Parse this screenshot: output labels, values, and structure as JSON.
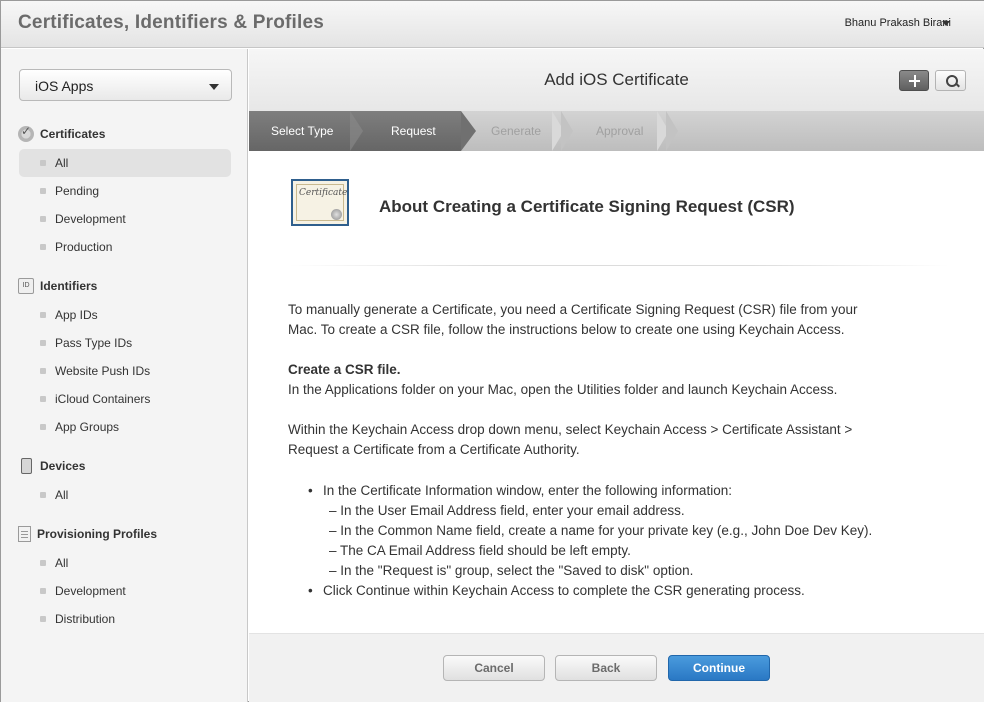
{
  "header": {
    "app_title": "Certificates, Identifiers & Profiles",
    "user_name": "Bhanu Prakash Birani"
  },
  "sidebar": {
    "app_select": "iOS Apps",
    "sections": [
      {
        "title": "Certificates",
        "icon": "certificate-icon",
        "items": [
          "All",
          "Pending",
          "Development",
          "Production"
        ],
        "active": "All"
      },
      {
        "title": "Identifiers",
        "icon": "id-badge-icon",
        "icon_text": "ID",
        "items": [
          "App IDs",
          "Pass Type IDs",
          "Website Push IDs",
          "iCloud Containers",
          "App Groups"
        ]
      },
      {
        "title": "Devices",
        "icon": "iphone-icon",
        "items": [
          "All"
        ]
      },
      {
        "title": "Provisioning Profiles",
        "icon": "document-icon",
        "items": [
          "All",
          "Development",
          "Distribution"
        ]
      }
    ]
  },
  "main": {
    "title": "Add iOS Certificate",
    "steps": [
      {
        "label": "Select Type",
        "state": "done"
      },
      {
        "label": "Request",
        "state": "current"
      },
      {
        "label": "Generate",
        "state": "upcoming"
      },
      {
        "label": "Approval",
        "state": "upcoming"
      }
    ],
    "cert_image_text": "Certificate",
    "content_title": "About Creating a Certificate Signing Request (CSR)",
    "intro_line1": "To manually generate a Certificate, you need a Certificate Signing Request (CSR) file from your",
    "intro_line2": "Mac. To create a CSR file, follow the instructions below to create one using Keychain Access.",
    "csr_heading": "Create a CSR file.",
    "csr_line": "In the Applications folder on your Mac, open the Utilities folder and launch Keychain Access.",
    "keychain_line1": "Within the Keychain Access drop down menu, select Keychain Access > Certificate Assistant >",
    "keychain_line2": "Request a Certificate from a Certificate Authority.",
    "bullet1": "In the Certificate Information window, enter the following information:",
    "sub_items": [
      "– In the User Email Address field, enter your email address.",
      "– In the Common Name field, create a name for your private key (e.g., John Doe Dev Key).",
      "– The CA Email Address field should be left empty.",
      "– In the \"Request is\" group, select the \"Saved to disk\" option."
    ],
    "bullet2": "Click Continue within Keychain Access to complete the CSR generating process."
  },
  "footer": {
    "cancel": "Cancel",
    "back": "Back",
    "continue": "Continue"
  },
  "colors": {
    "continue_button": "#2a78c4",
    "step_done": "#6e6e6e",
    "step_upcoming": "#c9c9c9",
    "sidebar_bg": "#f4f4f4"
  }
}
